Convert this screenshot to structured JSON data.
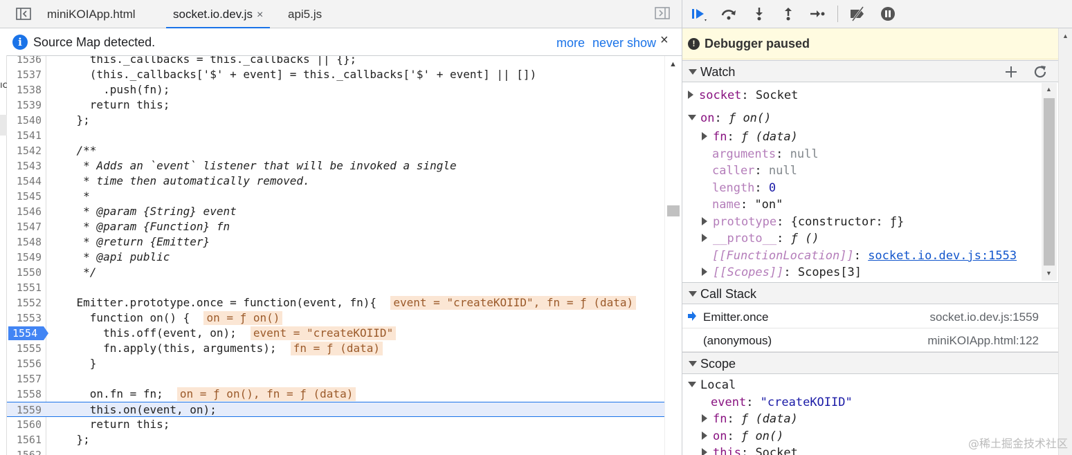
{
  "left": {
    "tabs": [
      {
        "label": "miniKOIApp.html",
        "active": false
      },
      {
        "label": "socket.io.dev.js",
        "active": true,
        "close": "×"
      },
      {
        "label": "api5.js",
        "active": false
      }
    ],
    "infobar": {
      "icon": "i",
      "text": "Source Map detected.",
      "more": "more",
      "never_show": "never show",
      "close": "×"
    },
    "code_lines": [
      {
        "n": "1536",
        "text": "      this._callbacks = this._callbacks || {};"
      },
      {
        "n": "1537",
        "text": "      (this._callbacks['$' + event] = this._callbacks['$' + event] || [])"
      },
      {
        "n": "1538",
        "text": "        .push(fn);"
      },
      {
        "n": "1539",
        "text": "      return this;"
      },
      {
        "n": "1540",
        "text": "    };"
      },
      {
        "n": "1541",
        "text": ""
      },
      {
        "n": "1542",
        "text": "    /**"
      },
      {
        "n": "1543",
        "text": "     * Adds an `event` listener that will be invoked a single"
      },
      {
        "n": "1544",
        "text": "     * time then automatically removed."
      },
      {
        "n": "1545",
        "text": "     *"
      },
      {
        "n": "1546",
        "text": "     * @param {String} event"
      },
      {
        "n": "1547",
        "text": "     * @param {Function} fn"
      },
      {
        "n": "1548",
        "text": "     * @return {Emitter}"
      },
      {
        "n": "1549",
        "text": "     * @api public"
      },
      {
        "n": "1550",
        "text": "     */"
      },
      {
        "n": "1551",
        "text": ""
      },
      {
        "n": "1552",
        "text": "    Emitter.prototype.once = function(event, fn){",
        "inline": "event = \"createKOIID\", fn = ƒ (data)"
      },
      {
        "n": "1553",
        "text": "      function on() {",
        "inline": "on = ƒ on()"
      },
      {
        "n": "1554",
        "text": "        this.off(event, on);",
        "inline": "event = \"createKOIID\"",
        "breakpoint": true
      },
      {
        "n": "1555",
        "text": "        fn.apply(this, arguments);",
        "inline": "fn = ƒ (data)"
      },
      {
        "n": "1556",
        "text": "      }"
      },
      {
        "n": "1557",
        "text": ""
      },
      {
        "n": "1558",
        "text": "      on.fn = fn;",
        "inline": "on = ƒ on(), fn = ƒ (data)"
      },
      {
        "n": "1559",
        "text": "      this.on(event, on);",
        "current": true
      },
      {
        "n": "1560",
        "text": "      return this;"
      },
      {
        "n": "1561",
        "text": "    };"
      },
      {
        "n": "1562",
        "text": ""
      }
    ]
  },
  "right": {
    "toolbar_icons": [
      "resume-icon",
      "step-over-icon",
      "step-into-icon",
      "step-out-icon",
      "step-icon",
      "deactivate-breakpoints-icon",
      "pause-on-exceptions-icon"
    ],
    "paused_banner": "Debugger paused",
    "watch": {
      "title": "Watch",
      "rows": [
        {
          "key": "socket",
          "sep": ": ",
          "val": "Socket"
        },
        {
          "key": "on",
          "sep": ": ",
          "val": "ƒ on()"
        },
        {
          "key": "fn",
          "sep": ": ",
          "val": "ƒ (data)"
        },
        {
          "key": "arguments",
          "sep": ": ",
          "val": "null"
        },
        {
          "key": "caller",
          "sep": ": ",
          "val": "null"
        },
        {
          "key": "length",
          "sep": ": ",
          "val": "0"
        },
        {
          "key": "name",
          "sep": ": ",
          "val": "\"on\""
        },
        {
          "key": "prototype",
          "sep": ": ",
          "val": "{constructor: ƒ}"
        },
        {
          "key": "__proto__",
          "sep": ": ",
          "val": "ƒ ()"
        },
        {
          "key": "[[FunctionLocation]]",
          "sep": ": ",
          "val": "socket.io.dev.js:1553"
        },
        {
          "key": "[[Scopes]]",
          "sep": ": ",
          "val": "Scopes[3]"
        }
      ]
    },
    "call_stack": {
      "title": "Call Stack",
      "frames": [
        {
          "name": "Emitter.once",
          "loc": "socket.io.dev.js:1559"
        },
        {
          "name": "(anonymous)",
          "loc": "miniKOIApp.html:122"
        }
      ]
    },
    "scope": {
      "title": "Scope",
      "local_label": "Local",
      "rows": [
        {
          "key": "event",
          "sep": ": ",
          "val": "\"createKOIID\""
        },
        {
          "key": "fn",
          "sep": ": ",
          "val": "ƒ (data)"
        },
        {
          "key": "on",
          "sep": ": ",
          "val": "ƒ on()"
        },
        {
          "key": "this",
          "sep": ": ",
          "val": "Socket"
        }
      ]
    },
    "watermark": "@稀土掘金技术社区"
  }
}
